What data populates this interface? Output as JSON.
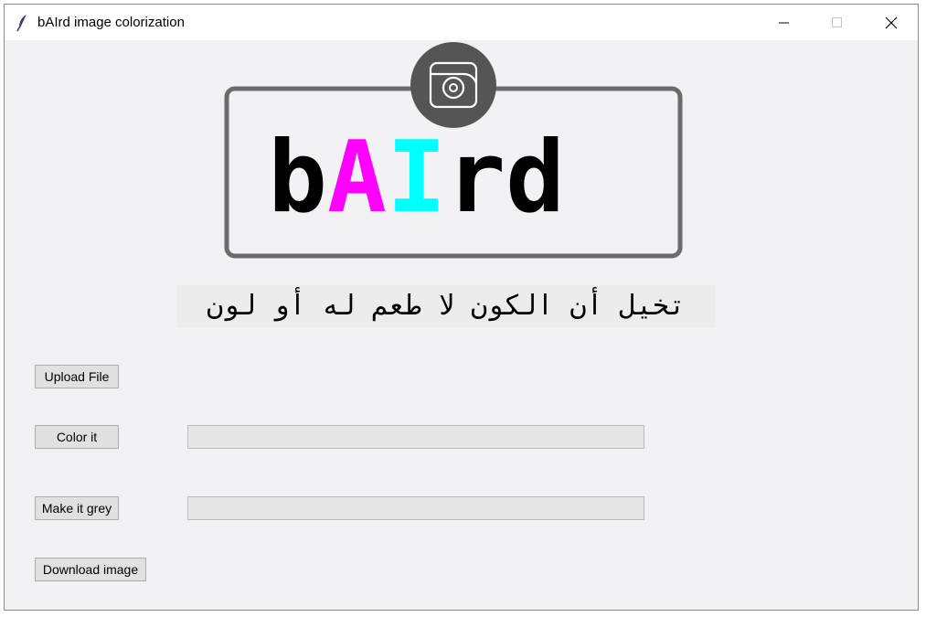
{
  "window": {
    "title": "bAIrd image colorization"
  },
  "logo": {
    "wordmark": "bAIrd",
    "camera_icon": "camera-icon"
  },
  "tagline": "تخيل أن الكون لا طعم له أو لون",
  "buttons": {
    "upload": "Upload File",
    "color": "Color it",
    "grey": "Make it grey",
    "download": "Download image"
  },
  "progress": {
    "color_fraction": 0,
    "grey_fraction": 0
  },
  "colors": {
    "magenta": "#ff00ff",
    "cyan": "#00ffff",
    "frame": "#6b6b6b",
    "camera_bg": "#555555"
  }
}
